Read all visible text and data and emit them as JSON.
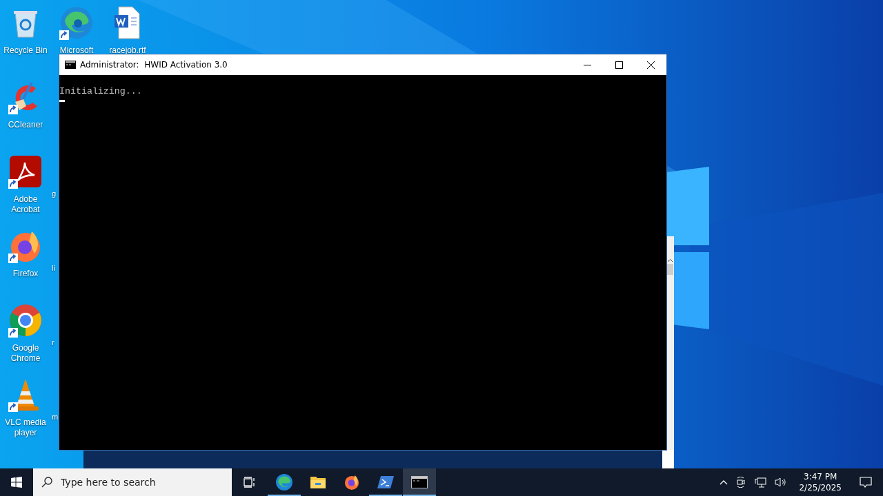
{
  "desktop_icons": [
    {
      "label": "Recycle Bin",
      "kind": "recycle-bin",
      "shortcut": false
    },
    {
      "label": "CCleaner",
      "kind": "ccleaner",
      "shortcut": true
    },
    {
      "label": "Adobe Acrobat",
      "kind": "acrobat",
      "shortcut": true
    },
    {
      "label": "Firefox",
      "kind": "firefox",
      "shortcut": true
    },
    {
      "label": "Google Chrome",
      "kind": "chrome",
      "shortcut": true
    },
    {
      "label": "VLC media player",
      "kind": "vlc",
      "shortcut": true
    }
  ],
  "desktop_icons_top": [
    {
      "label": "Microsoft",
      "kind": "edge",
      "shortcut": true
    },
    {
      "label": "racejob.rtf",
      "kind": "word",
      "shortcut": false
    }
  ],
  "hidden_labels": [
    "g",
    "li",
    "r",
    "m"
  ],
  "console": {
    "title": "Administrator:  HWID Activation 3.0",
    "lines": [
      "Initializing..."
    ],
    "cursor": true
  },
  "taskbar": {
    "search": {
      "placeholder": "Type here to search"
    },
    "apps": [
      {
        "kind": "edge",
        "running": true,
        "selected": false
      },
      {
        "kind": "explorer",
        "running": false,
        "selected": false
      },
      {
        "kind": "firefox",
        "running": false,
        "selected": false
      },
      {
        "kind": "powershell",
        "running": true,
        "selected": false
      },
      {
        "kind": "cmd",
        "running": true,
        "selected": true
      }
    ],
    "time": "3:47 PM",
    "date": "2/25/2025"
  }
}
